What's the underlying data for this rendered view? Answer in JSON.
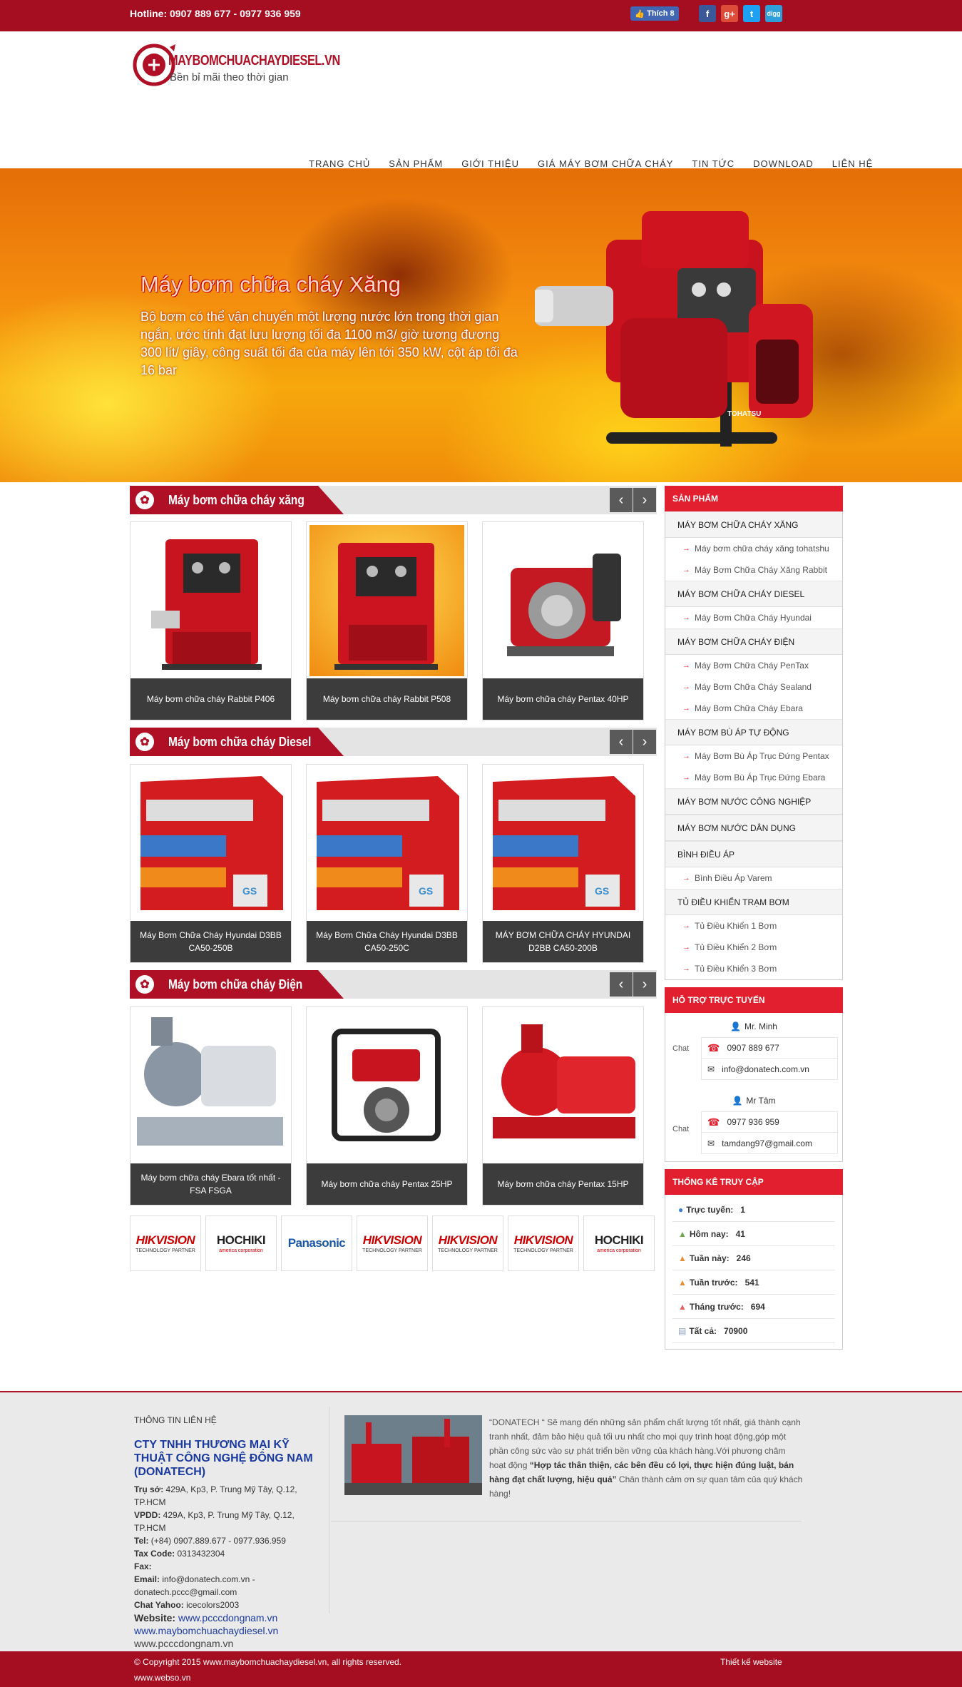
{
  "topbar": {
    "hotline": "Hotline: 0907 889 677  -  0977 936 959",
    "fb_like": "Thích 8"
  },
  "header": {
    "logo_name": "MAYBOMCHUACHAYDIESEL.VN",
    "logo_tagline": "Bền bỉ mãi theo thời gian"
  },
  "nav": [
    "TRANG CHỦ",
    "SẢN PHẨM",
    "GIỚI THIỆU",
    "GIÁ MÁY BƠM CHỮA CHÁY",
    "TIN TỨC",
    "DOWNLOAD",
    "LIÊN HỆ"
  ],
  "banner": {
    "title": "Máy bơm chữa cháy Xăng",
    "description": "Bộ bơm có thể vận chuyển một lượng nước lớn trong thời gian ngắn, ước tính đạt lưu lượng tối đa 1100 m3/ giờ tương đương 300 lít/ giây, công suất tối đa của máy lên tới 350 kW, cột áp tối đa 16 bar",
    "product_brand": "TOHATSU"
  },
  "sections": [
    {
      "title": "Máy bơm chữa cháy xăng",
      "products": [
        "Máy bơm chữa cháy Rabbit P406",
        "Máy bơm chữa cháy Rabbit P508",
        "Máy bơm chữa cháy Pentax 40HP"
      ]
    },
    {
      "title": "Máy bơm chữa cháy Diesel",
      "products": [
        "Máy Bơm Chữa Cháy Hyundai D3BB CA50-250B",
        "Máy Bơm Chữa Cháy Hyundai D3BB CA50-250C",
        "MÁY BƠM CHỮA CHÁY HYUNDAI D2BB CA50-200B"
      ]
    },
    {
      "title": "Máy bơm chữa cháy Điện",
      "products": [
        "Máy bơm chữa cháy Ebara tốt nhất - FSA FSGA",
        "Máy bơm chữa cháy Pentax 25HP",
        "Máy bơm chữa cháy Pentax 15HP"
      ]
    }
  ],
  "partners": [
    {
      "name": "HIKVISION",
      "sub": "TECHNOLOGY PARTNER"
    },
    {
      "name": "HOCHIKI",
      "sub": "america corporation"
    },
    {
      "name": "Panasonic",
      "sub": ""
    },
    {
      "name": "HIKVISION",
      "sub": "TECHNOLOGY PARTNER"
    },
    {
      "name": "HIKVISION",
      "sub": "TECHNOLOGY PARTNER"
    },
    {
      "name": "HIKVISION",
      "sub": "TECHNOLOGY PARTNER"
    },
    {
      "name": "HOCHIKI",
      "sub": "america corporation"
    }
  ],
  "sidebar": {
    "products_title": "SẢN PHẨM",
    "categories": [
      {
        "name": "MÁY BƠM CHỮA CHÁY XĂNG",
        "subs": [
          "Máy bơm chữa cháy xăng tohatshu",
          "Máy Bơm Chữa Cháy Xăng Rabbit"
        ]
      },
      {
        "name": "MÁY BƠM CHỮA CHÁY DIESEL",
        "subs": [
          "Máy Bơm Chữa Cháy Hyundai"
        ]
      },
      {
        "name": "MÁY BƠM CHỮA CHÁY ĐIỆN",
        "subs": [
          "Máy Bơm Chữa Cháy PenTax",
          "Máy Bơm Chữa Cháy Sealand",
          "Máy Bơm Chữa Cháy Ebara"
        ]
      },
      {
        "name": "MÁY BƠM BÙ ÁP TỰ ĐỘNG",
        "subs": [
          "Máy Bơm Bù Áp Trục Đứng Pentax",
          "Máy Bơm Bù Áp Trục Đứng Ebara"
        ]
      },
      {
        "name": "MÁY BƠM NƯỚC CÔNG NGHIỆP",
        "subs": []
      },
      {
        "name": "MÁY BƠM NƯỚC DÂN DỤNG",
        "subs": []
      },
      {
        "name": "BÌNH ĐIỀU ÁP",
        "subs": [
          "Bình Điều Áp Varem"
        ]
      },
      {
        "name": "TỦ ĐIỀU KHIỂN TRẠM BƠM",
        "subs": [
          "Tủ Điều Khiển 1 Bơm",
          "Tủ Điều Khiển 2 Bơm",
          "Tủ Điều Khiển 3 Bơm"
        ]
      }
    ],
    "support_title": "HỖ TRỢ TRỰC TUYẾN",
    "supporters": [
      {
        "name": "Mr. Minh",
        "phone": "0907 889 677",
        "email": "info@donatech.com.vn",
        "chat": "Chat"
      },
      {
        "name": "Mr Tâm",
        "phone": "0977 936 959",
        "email": "tamdang97@gmail.com",
        "chat": "Chat"
      }
    ],
    "stats_title": "THỐNG KÊ TRUY CẬP",
    "stats": [
      {
        "label": "Trực tuyến:",
        "value": "1",
        "color": "#3b7fd0"
      },
      {
        "label": "Hôm nay:",
        "value": "41",
        "color": "#6aa84f"
      },
      {
        "label": "Tuần này:",
        "value": "246",
        "color": "#e69138"
      },
      {
        "label": "Tuần trước:",
        "value": "541",
        "color": "#e69138"
      },
      {
        "label": "Tháng trước:",
        "value": "694",
        "color": "#e06666"
      },
      {
        "label": "Tất cả:",
        "value": "70900",
        "color": "#8e9fc0"
      }
    ]
  },
  "footer": {
    "contact_heading": "THÔNG TIN LIÊN HỆ",
    "company": "CTY TNHH THƯƠNG MẠI KỸ THUẬT CÔNG NGHỆ ĐÔNG NAM (DONATECH)",
    "lines": [
      {
        "k": "Trụ sở:",
        "v": " 429A, Kp3, P. Trung Mỹ Tây, Q.12, TP.HCM"
      },
      {
        "k": "VPDD:",
        "v": " 429A, Kp3, P. Trung Mỹ Tây, Q.12, TP.HCM"
      },
      {
        "k": "Tel:",
        "v": " (+84) 0907.889.677 - 0977.936.959"
      },
      {
        "k": "Tax Code:",
        "v": " 0313432304"
      },
      {
        "k": "Fax:",
        "v": ""
      },
      {
        "k": "Email:",
        "v": " info@donatech.com.vn  -  donatech.pccc@gmail.com"
      },
      {
        "k": "Chat Yahoo:",
        "v": " icecolors2003"
      }
    ],
    "website_label": "Website:",
    "website1": "www.pcccdongnam.vn",
    "website2": "www.maybomchuachaydiesel.vn",
    "website3": "www.pcccdongnam.vn",
    "about_p1": "“DONATECH “ Sẽ mang đến những sản phẩm chất lượng tốt nhất, giá thành cạnh tranh nhất, đảm bảo hiệu quả tối ưu nhất cho mọi quy trình hoạt động,góp một phần công sức vào sự phát triển bền vững của khách hàng.Với phương châm hoạt động ",
    "about_bold": "“Hợp tác thân thiện, các bên đều có lợi, thực hiện đúng luật, bán hàng đạt chất lượng, hiệu quả”",
    "about_p2": " Chân thành cảm ơn sự quan tâm của quý khách hàng!"
  },
  "bottombar": {
    "copyright": "© Copyright 2015 www.maybomchuachaydiesel.vn, all rights reserved.",
    "design": "Thiết kế website",
    "design_url": "www.webso.vn"
  }
}
